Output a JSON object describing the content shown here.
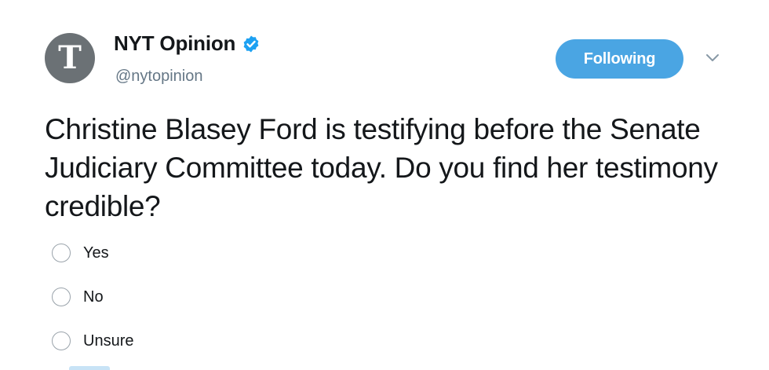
{
  "account": {
    "display_name": "NYT Opinion",
    "handle": "@nytopinion",
    "avatar_glyph": "T",
    "verified_icon": "verified-badge-icon",
    "verified_color": "#1da1f2"
  },
  "follow_button": {
    "label": "Following",
    "color": "#4aa5e3"
  },
  "menu": {
    "icon": "chevron-down-icon"
  },
  "tweet": {
    "text": "Christine Blasey Ford is testifying before the Senate Judiciary Committee today. Do you find her testimony credible?"
  },
  "poll": {
    "options": [
      {
        "label": "Yes"
      },
      {
        "label": "No"
      },
      {
        "label": "Unsure"
      }
    ]
  }
}
